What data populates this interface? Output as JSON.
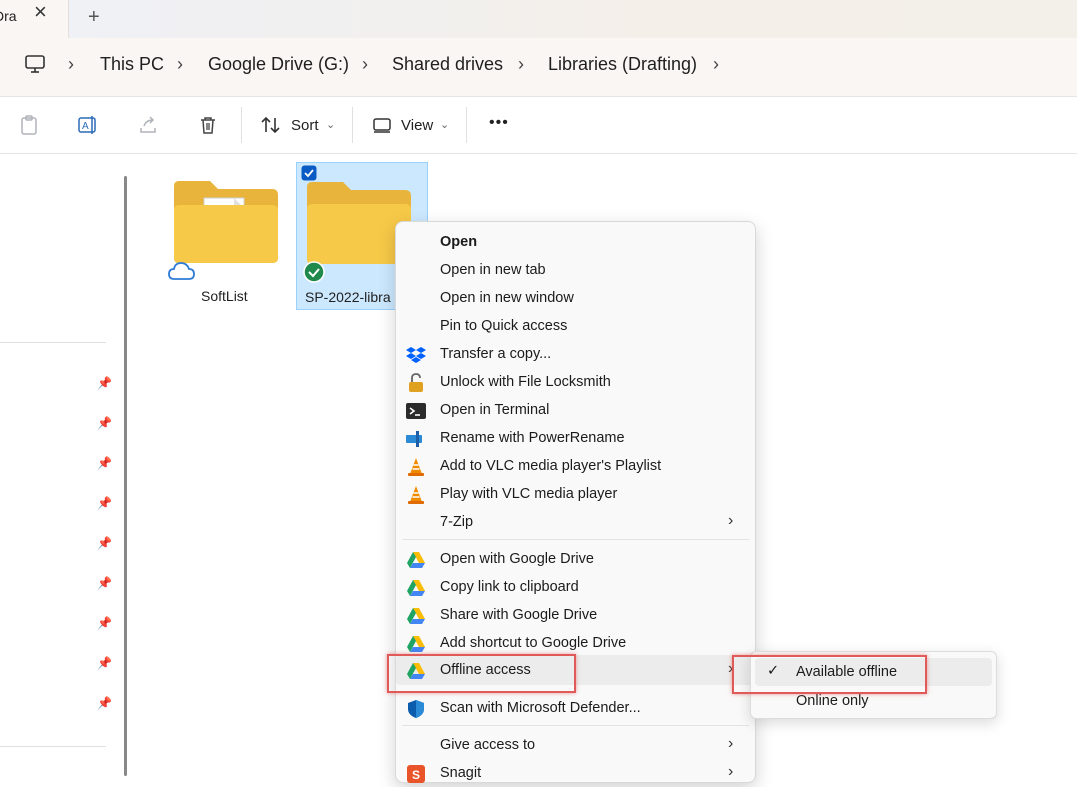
{
  "tab": {
    "label": "Dra"
  },
  "address": {
    "crumbs": [
      "This PC",
      "Google Drive (G:)",
      "Shared drives",
      "Libraries (Drafting)"
    ]
  },
  "toolbar": {
    "sort_label": "Sort",
    "view_label": "View",
    "more_label": "•••"
  },
  "folders": [
    {
      "name": "SoftList"
    },
    {
      "name": "SP-2022-libra"
    }
  ],
  "menu": {
    "items": [
      {
        "label": "Open"
      },
      {
        "label": "Open in new tab"
      },
      {
        "label": "Open in new window"
      },
      {
        "label": "Pin to Quick access"
      },
      {
        "label": "Transfer a copy..."
      },
      {
        "label": "Unlock with File Locksmith"
      },
      {
        "label": "Open in Terminal"
      },
      {
        "label": "Rename with PowerRename"
      },
      {
        "label": "Add to VLC media player's Playlist"
      },
      {
        "label": "Play with VLC media player"
      },
      {
        "label": "7-Zip"
      },
      {
        "label": "Open with Google Drive"
      },
      {
        "label": "Copy link to clipboard"
      },
      {
        "label": "Share with Google Drive"
      },
      {
        "label": "Add shortcut to Google Drive"
      },
      {
        "label": "Offline access"
      },
      {
        "label": "Scan with Microsoft Defender..."
      },
      {
        "label": "Give access to"
      },
      {
        "label": "Snagit"
      }
    ]
  },
  "submenu": {
    "items": [
      {
        "label": "Available offline",
        "check": "✓"
      },
      {
        "label": "Online only"
      }
    ]
  },
  "colors": {
    "selection": "#cce8ff",
    "highlight_box": "#e05a5a",
    "folder": "#f7c948"
  }
}
